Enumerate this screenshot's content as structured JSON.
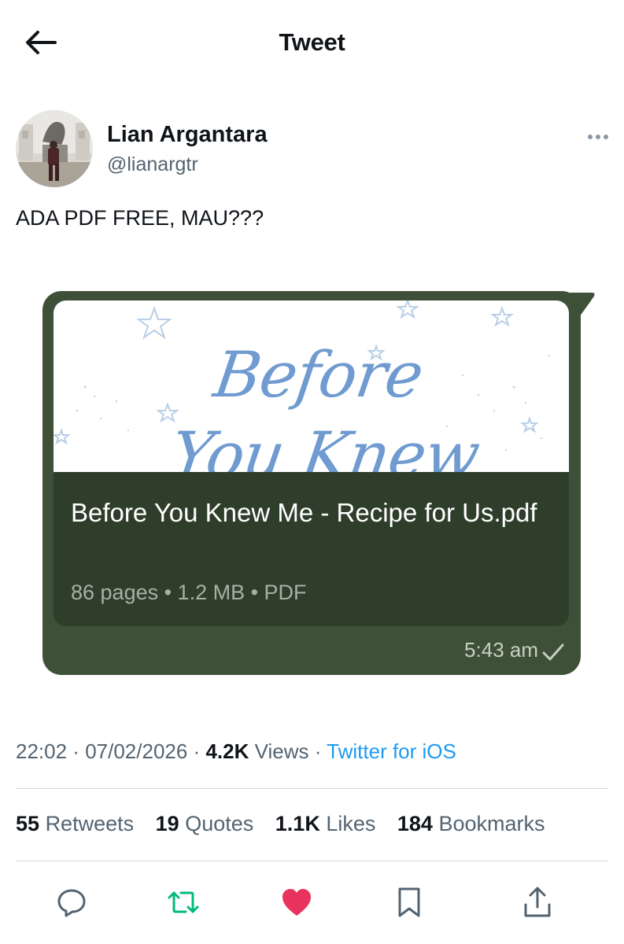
{
  "header": {
    "title": "Tweet"
  },
  "tweet": {
    "author_name": "Lian Argantara",
    "author_handle": "@lianargtr",
    "text": "ADA PDF FREE, MAU???",
    "media": {
      "preview_title_line1": "Before",
      "preview_title_line2": "You Knew",
      "doc_title": "Before You Knew Me - Recipe for Us.pdf",
      "doc_meta": "86 pages • 1.2 MB • PDF",
      "time": "5:43 am"
    },
    "time": "22:02",
    "date": "07/02/2026",
    "views_count": "4.2K",
    "views_label": "Views",
    "client": "Twitter for iOS"
  },
  "stats": {
    "retweets": {
      "count": "55",
      "label": "Retweets"
    },
    "quotes": {
      "count": "19",
      "label": "Quotes"
    },
    "likes": {
      "count": "1.1K",
      "label": "Likes"
    },
    "bookmarks": {
      "count": "184",
      "label": "Bookmarks"
    }
  },
  "actions": [
    "reply-icon",
    "retweet-icon",
    "like-icon",
    "bookmark-icon",
    "share-icon"
  ],
  "colors": {
    "text": "#0f1419",
    "secondary": "#536471",
    "link": "#1d9bf0",
    "retweet": "#00ba7c",
    "like": "#f91880",
    "bubble": "#3f5038"
  }
}
